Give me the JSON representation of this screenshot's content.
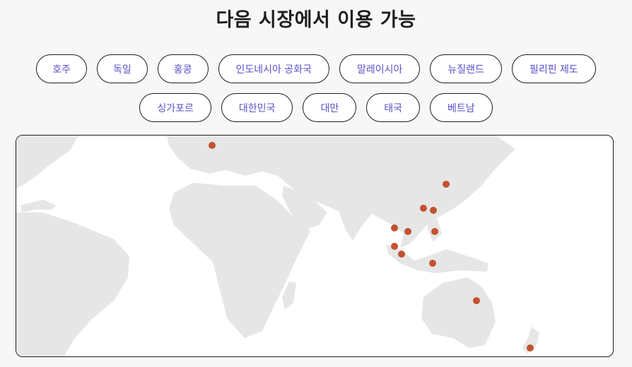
{
  "header": {
    "title": "다음 시장에서 이용 가능"
  },
  "markets": {
    "row1": [
      "호주",
      "독일",
      "홍콩",
      "인도네시아 공화국",
      "말레이시아",
      "뉴질랜드",
      "필리핀 제도"
    ],
    "row2": [
      "싱가포르",
      "대한민국",
      "대만",
      "태국",
      "베트남"
    ]
  },
  "map": {
    "marker_color": "#c4522f",
    "land_color": "#e6e6e6"
  }
}
